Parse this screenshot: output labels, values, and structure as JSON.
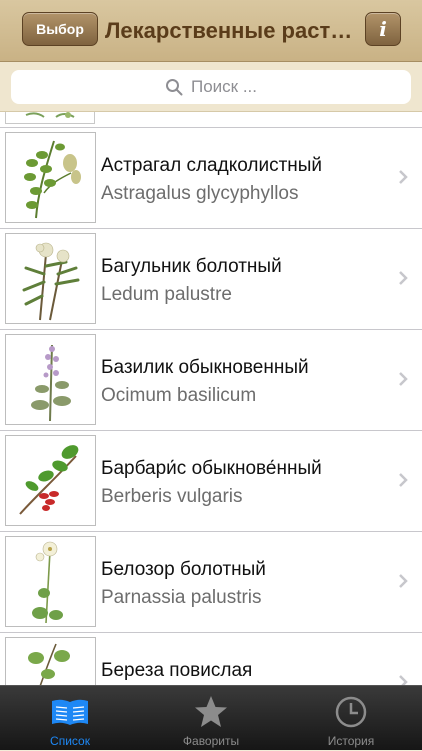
{
  "header": {
    "choose_label": "Выбор",
    "title": "Лекарственные растения",
    "info_label": "i"
  },
  "search": {
    "placeholder": "Поиск ..."
  },
  "list": {
    "items": [
      {
        "name": "Астрагал сладколистный",
        "latin": "Astragalus glycyphyllos"
      },
      {
        "name": "Багульник болотный",
        "latin": "Ledum palustre"
      },
      {
        "name": "Базилик обыкновенный",
        "latin": "Ocimum basilicum"
      },
      {
        "name": "Барбари́с обыкнове́нный",
        "latin": "Berberis vulgaris"
      },
      {
        "name": "Белозор болотный",
        "latin": "Parnassia palustris"
      },
      {
        "name": "Береза повислая",
        "latin": ""
      }
    ]
  },
  "tabbar": {
    "tabs": [
      {
        "label": "Список",
        "icon": "book-icon",
        "active": true
      },
      {
        "label": "Фавориты",
        "icon": "star-icon",
        "active": false
      },
      {
        "label": "История",
        "icon": "clock-icon",
        "active": false
      }
    ]
  },
  "colors": {
    "accent": "#1e88f5",
    "header_title": "#5a3c1a",
    "button_brown": "#8a6c45"
  }
}
